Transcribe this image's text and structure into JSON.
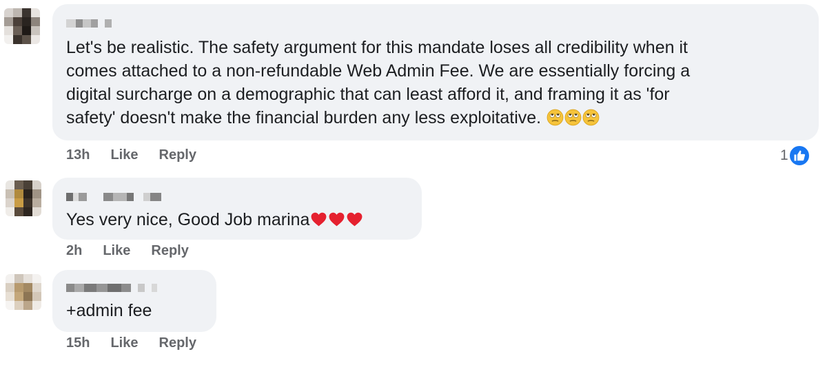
{
  "comments": [
    {
      "text": "Let's be realistic. The safety argument for this mandate loses all credibility when it\ncomes attached to a non-refundable Web Admin Fee. We are essentially forcing a\ndigital surcharge on a demographic that can least afford it, and framing it as 'for\nsafety' doesn't make the financial burden any less exploitative. ",
      "emojis": [
        "rolling-eyes",
        "rolling-eyes",
        "rolling-eyes"
      ],
      "time": "13h",
      "like_label": "Like",
      "reply_label": "Reply",
      "reaction_count": "1"
    },
    {
      "text": "Yes very nice, Good Job marina",
      "emojis": [
        "red-heart",
        "red-heart",
        "red-heart"
      ],
      "time": "2h",
      "like_label": "Like",
      "reply_label": "Reply"
    },
    {
      "text": "+admin fee",
      "time": "15h",
      "like_label": "Like",
      "reply_label": "Reply"
    }
  ],
  "colors": {
    "bubble": "#f0f2f5",
    "action_text": "#65676b",
    "like_blue": "#1877f2"
  }
}
